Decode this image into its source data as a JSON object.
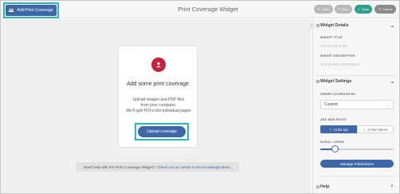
{
  "toolbar": {
    "add_label": "Add Print Coverage",
    "title": "Print Coverage Widget",
    "undo_label": "Undo",
    "redo_label": "Redo",
    "save_label": "Save",
    "cancel_label": "Cancel"
  },
  "empty_state": {
    "heading": "Add some print coverage",
    "line1": "Upload images and PDF files",
    "line2": "from your computer.",
    "line3": "We'll split PDFs into individual pages",
    "upload_label": "Upload coverage"
  },
  "help_banner": {
    "text": "Need help with the Print Coverage Widget?",
    "link": "Check out our article in the Knowledge Base."
  },
  "panel": {
    "details": {
      "title": "Widget Details",
      "title_label": "WIDGET TITLE",
      "title_placeholder": "click to add a title",
      "desc_label": "WIDGET DESCRIPTION",
      "desc_placeholder": "click to add a description"
    },
    "settings": {
      "title": "Widget Settings",
      "order_label": "ORDER COVERAGE BY",
      "order_value": "Custom",
      "new_posts_label": "ADD NEW POSTS",
      "at_top": "At the top",
      "at_bottom": "At the bottom",
      "scroll_label": "SCROLL SPEED",
      "scroll_value": 0.2,
      "manage_label": "Manage Publications"
    },
    "help_title": "Help"
  },
  "colors": {
    "accent": "#3d67a6",
    "highlight": "#27b7bc",
    "save": "#2e9f8f",
    "brand_icon": "#c7213c"
  }
}
